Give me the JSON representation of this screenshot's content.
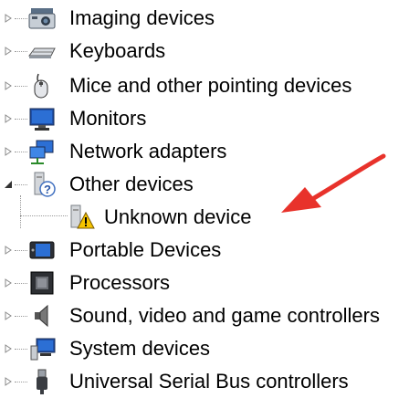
{
  "device_tree": {
    "items": [
      {
        "label": "Imaging devices",
        "icon": "camera-icon",
        "state": "collapsed"
      },
      {
        "label": "Keyboards",
        "icon": "keyboard-icon",
        "state": "collapsed"
      },
      {
        "label": "Mice and other pointing devices",
        "icon": "mouse-icon",
        "state": "collapsed"
      },
      {
        "label": "Monitors",
        "icon": "monitor-icon",
        "state": "collapsed"
      },
      {
        "label": "Network adapters",
        "icon": "network-adapter-icon",
        "state": "collapsed"
      },
      {
        "label": "Other devices",
        "icon": "unknown-device-icon",
        "state": "expanded",
        "children": [
          {
            "label": "Unknown device",
            "icon": "warning-device-icon"
          }
        ]
      },
      {
        "label": "Portable Devices",
        "icon": "portable-device-icon",
        "state": "collapsed"
      },
      {
        "label": "Processors",
        "icon": "processor-icon",
        "state": "collapsed"
      },
      {
        "label": "Sound, video and game controllers",
        "icon": "speaker-icon",
        "state": "collapsed"
      },
      {
        "label": "System devices",
        "icon": "system-devices-icon",
        "state": "collapsed"
      },
      {
        "label": "Universal Serial Bus controllers",
        "icon": "usb-icon",
        "state": "collapsed"
      }
    ]
  },
  "annotation": {
    "arrow_color": "#e8322b",
    "icon": "red-arrow-icon"
  },
  "colors": {
    "warning": "#f5c400",
    "monitor_blue": "#1e4fa8"
  }
}
